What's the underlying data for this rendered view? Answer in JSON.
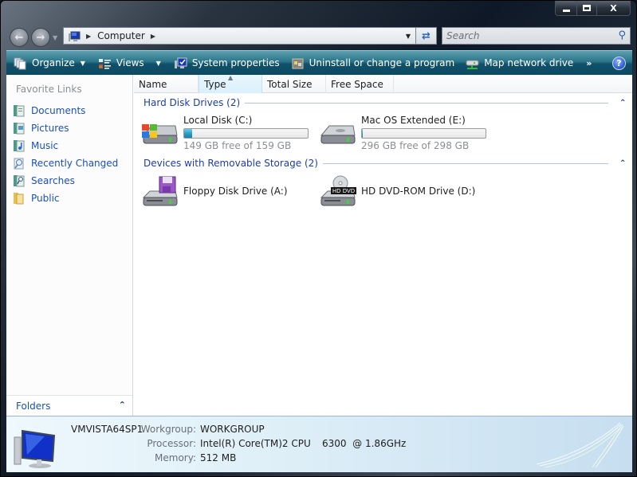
{
  "window": {
    "caption_buttons": {
      "minimize": "–",
      "maximize": "□",
      "close": "X"
    }
  },
  "navigation": {
    "back_icon": "back-arrow-icon",
    "forward_icon": "forward-arrow-icon",
    "address": {
      "icon": "computer-icon",
      "path": [
        "Computer"
      ]
    },
    "search_placeholder": "Search"
  },
  "toolbar": {
    "items": [
      {
        "label": "Organize",
        "icon": "organize-icon",
        "has_dropdown": true
      },
      {
        "label": "Views",
        "icon": "views-icon",
        "has_dropdown": true
      },
      {
        "label": "System properties",
        "icon": "system-properties-icon"
      },
      {
        "label": "Uninstall or change a program",
        "icon": "uninstall-icon"
      },
      {
        "label": "Map network drive",
        "icon": "network-drive-icon"
      }
    ],
    "overflow": "»",
    "help": "?"
  },
  "sidebar": {
    "title": "Favorite Links",
    "items": [
      {
        "label": "Documents",
        "icon": "documents-icon"
      },
      {
        "label": "Pictures",
        "icon": "pictures-icon"
      },
      {
        "label": "Music",
        "icon": "music-icon"
      },
      {
        "label": "Recently Changed",
        "icon": "recently-changed-icon"
      },
      {
        "label": "Searches",
        "icon": "searches-icon"
      },
      {
        "label": "Public",
        "icon": "public-folder-icon"
      }
    ],
    "folders_label": "Folders"
  },
  "columns": [
    {
      "label": "Name"
    },
    {
      "label": "Type",
      "sorted": "ascending"
    },
    {
      "label": "Total Size"
    },
    {
      "label": "Free Space"
    }
  ],
  "groups": [
    {
      "title": "Hard Disk Drives (2)",
      "items": [
        {
          "name": "Local Disk (C:)",
          "free_text": "149 GB free of 159 GB",
          "used_fraction": 0.063,
          "icon": "windows-hard-disk-icon"
        },
        {
          "name": "Mac OS Extended (E:)",
          "free_text": "296 GB free of 298 GB",
          "used_fraction": 0.007,
          "icon": "hard-disk-icon"
        }
      ]
    },
    {
      "title": "Devices with Removable Storage (2)",
      "items": [
        {
          "name": "Floppy Disk Drive (A:)",
          "icon": "floppy-drive-icon"
        },
        {
          "name": "HD DVD-ROM Drive (D:)",
          "icon": "hd-dvd-drive-icon",
          "badge": "HD DVD"
        }
      ]
    }
  ],
  "details": {
    "computer_name": "VMVISTA64SP1",
    "workgroup_label": "Workgroup:",
    "workgroup": "WORKGROUP",
    "processor_label": "Processor:",
    "processor": "Intel(R) Core(TM)2 CPU",
    "processor_speed": "6300  @ 1.86GHz",
    "memory_label": "Memory:",
    "memory": "512 MB"
  }
}
